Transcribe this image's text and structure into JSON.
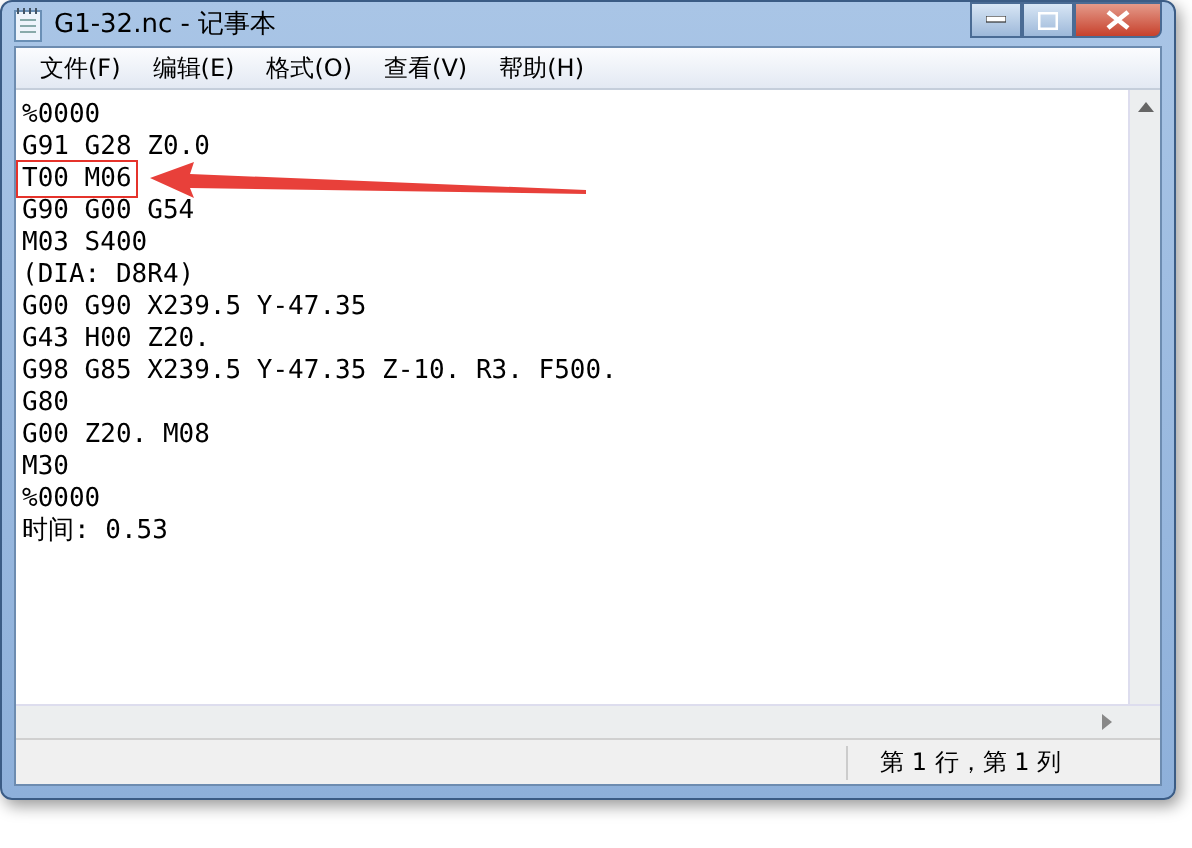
{
  "window": {
    "title": "G1-32.nc - 记事本"
  },
  "menu": [
    {
      "label": "文件(F)"
    },
    {
      "label": "编辑(E)"
    },
    {
      "label": "格式(O)"
    },
    {
      "label": "查看(V)"
    },
    {
      "label": "帮助(H)"
    }
  ],
  "lines": [
    {
      "text": "%0000",
      "boxed": false
    },
    {
      "text": "G91 G28 Z0.0",
      "boxed": false
    },
    {
      "text": "T00 M06",
      "boxed": true
    },
    {
      "text": "G90 G00 G54",
      "boxed": false
    },
    {
      "text": "M03 S400",
      "boxed": false
    },
    {
      "text": "(DIA: D8R4)",
      "boxed": false
    },
    {
      "text": "G00 G90 X239.5 Y-47.35",
      "boxed": false
    },
    {
      "text": "G43 H00 Z20.",
      "boxed": false
    },
    {
      "text": "G98 G85 X239.5 Y-47.35 Z-10. R3. F500.",
      "boxed": false
    },
    {
      "text": "G80",
      "boxed": false
    },
    {
      "text": "G00 Z20. M08",
      "boxed": false
    },
    {
      "text": "M30",
      "boxed": false
    },
    {
      "text": "%0000",
      "boxed": false
    },
    {
      "text": "时间: 0.53",
      "boxed": false
    }
  ],
  "status_bar": {
    "position": "第 1 行，第 1 列"
  }
}
